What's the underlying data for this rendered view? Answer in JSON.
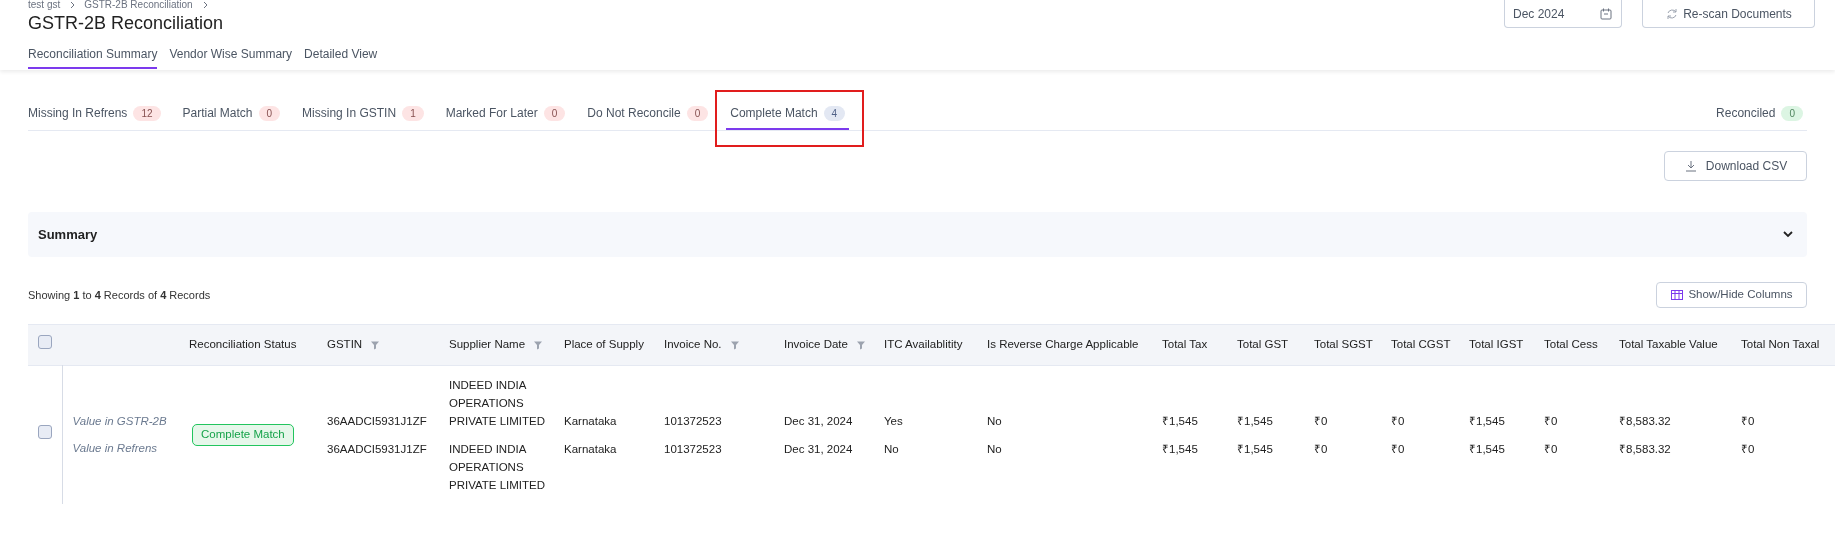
{
  "breadcrumb": [
    "test gst",
    "GSTR-2B Reconciliation"
  ],
  "title": "GSTR-2B Reconciliation",
  "period": {
    "value": "Dec 2024"
  },
  "rescan_button": "Re-scan Documents",
  "view_tabs": [
    {
      "label": "Reconciliation Summary",
      "selected": true
    },
    {
      "label": "Vendor Wise Summary",
      "selected": false
    },
    {
      "label": "Detailed View",
      "selected": false
    }
  ],
  "status_tabs": [
    {
      "label": "Missing In Refrens",
      "count": "12",
      "color": "#fde4e4",
      "selected": false,
      "highlighted": false
    },
    {
      "label": "Partial Match",
      "count": "0",
      "color": "#fde4e4",
      "selected": false,
      "highlighted": false
    },
    {
      "label": "Missing In GSTIN",
      "count": "1",
      "color": "#fde4e4",
      "selected": false,
      "highlighted": false
    },
    {
      "label": "Marked For Later",
      "count": "0",
      "color": "#fde4e4",
      "selected": false,
      "highlighted": false
    },
    {
      "label": "Do Not Reconcile",
      "count": "0",
      "color": "#fde4e4",
      "selected": false,
      "highlighted": false
    },
    {
      "label": "Complete Match",
      "count": "4",
      "color": "#e3e8f3",
      "selected": true,
      "highlighted": true
    }
  ],
  "reconciled_tab": {
    "label": "Reconciled",
    "count": "0",
    "color": "#dcf5e3",
    "selected": false
  },
  "download_button": "Download CSV",
  "summary": {
    "title": "Summary",
    "expanded": false
  },
  "records_info": "Showing **1** to **4** Records of **4** Records",
  "columns_button": "Show/Hide Columns",
  "table": {
    "all_checked": false,
    "columns": [
      {
        "label": "Reconciliation Status",
        "filter": false
      },
      {
        "label": "GSTIN",
        "filter": true
      },
      {
        "label": "Supplier Name",
        "filter": true
      },
      {
        "label": "Place of Supply",
        "filter": false
      },
      {
        "label": "Invoice No.",
        "filter": true
      },
      {
        "label": "Invoice Date",
        "filter": true
      },
      {
        "label": "ITC Availablitity",
        "filter": false
      },
      {
        "label": "Is Reverse Charge Applicable",
        "filter": false
      },
      {
        "label": "Total Tax",
        "filter": false
      },
      {
        "label": "Total GST",
        "filter": false
      },
      {
        "label": "Total SGST",
        "filter": false
      },
      {
        "label": "Total CGST",
        "filter": false
      },
      {
        "label": "Total IGST",
        "filter": false
      },
      {
        "label": "Total Cess",
        "filter": false
      },
      {
        "label": "Total Taxable Value",
        "filter": false
      },
      {
        "label": "Total Non Taxal",
        "filter": false
      }
    ],
    "rows": [
      {
        "checked": false,
        "status": "Complete Match",
        "lines": [
          {
            "source": "Value in GSTR-2B",
            "cells": [
              "36AADCI5931J1ZF",
              "INDEED INDIA OPERATIONS PRIVATE LIMITED",
              "Karnataka",
              "101372523",
              "Dec 31, 2024",
              "Yes",
              "No",
              "₹1,545",
              "₹1,545",
              "₹0",
              "₹0",
              "₹1,545",
              "₹0",
              "₹8,583.32",
              "₹0"
            ]
          },
          {
            "source": "Value in Refrens",
            "cells": [
              "36AADCI5931J1ZF",
              "INDEED INDIA OPERATIONS PRIVATE LIMITED",
              "Karnataka",
              "101372523",
              "Dec 31, 2024",
              "No",
              "No",
              "₹1,545",
              "₹1,545",
              "₹0",
              "₹0",
              "₹1,545",
              "₹0",
              "₹8,583.32",
              "₹0"
            ]
          }
        ]
      }
    ]
  }
}
